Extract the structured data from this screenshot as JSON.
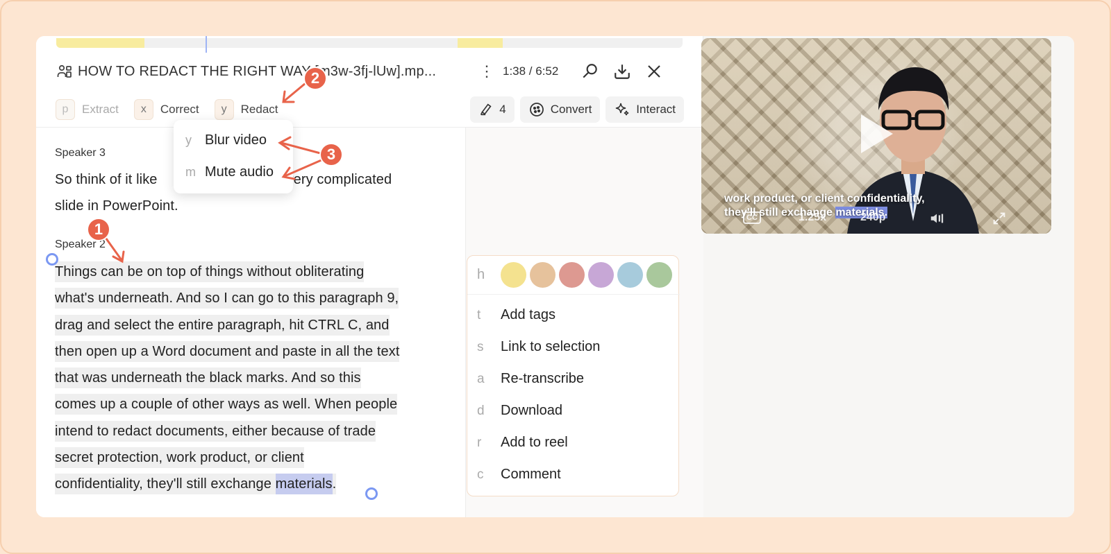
{
  "file": {
    "title": "HOW TO REDACT THE RIGHT WAY [m3w-3fj-lUw].mp...",
    "time": "1:38 / 6:52"
  },
  "toolbar": {
    "extract": {
      "key": "p",
      "label": "Extract"
    },
    "correct": {
      "key": "x",
      "label": "Correct"
    },
    "redact": {
      "key": "y",
      "label": "Redact"
    },
    "highlight_count": "4",
    "convert_label": "Convert",
    "interact_label": "Interact"
  },
  "redact_menu": {
    "items": [
      {
        "key": "y",
        "label": "Blur video"
      },
      {
        "key": "m",
        "label": "Mute audio"
      }
    ]
  },
  "transcript": {
    "blocks": [
      {
        "speaker": "Speaker 3",
        "lines": [
          "So think of it like",
          "very complicated",
          "slide in PowerPoint."
        ]
      },
      {
        "speaker": "Speaker 2",
        "lines": [
          "Things can be on top of things without obliterating",
          "what's underneath. And so I can go to this paragraph 9,",
          "drag and select the entire paragraph, hit CTRL C, and",
          "then open up a Word document and paste in all the text",
          "that was underneath the black marks. And so this",
          "comes up a couple of other ways as well. When people",
          "intend to redact documents, either because of trade",
          "secret protection, work product, or client",
          "confidentiality, they'll still exchange "
        ],
        "highlight_word": "materials",
        "trailing": "."
      }
    ]
  },
  "context_menu": {
    "highlight_key": "h",
    "swatch_colors": [
      "#f4e28f",
      "#e6c29c",
      "#dd9991",
      "#c7a7d6",
      "#a7cbdc",
      "#a9c89c"
    ],
    "items": [
      {
        "key": "t",
        "label": "Add tags"
      },
      {
        "key": "s",
        "label": "Link to selection"
      },
      {
        "key": "a",
        "label": "Re-transcribe"
      },
      {
        "key": "d",
        "label": "Download"
      },
      {
        "key": "r",
        "label": "Add to reel"
      },
      {
        "key": "c",
        "label": "Comment"
      }
    ]
  },
  "video": {
    "caption_line1": "work product, or client confidentiality,",
    "caption_line2_pre": "they'll still exchange ",
    "caption_line2_hl": "materials.",
    "cc_label": "CC",
    "speed": "1.25x",
    "quality": "240p"
  },
  "annotations": [
    "1",
    "2",
    "3"
  ],
  "colors": {
    "accent_annotation": "#e8634a",
    "selection_handle": "#7b98f2",
    "word_highlight": "#c6ccef",
    "page_background": "#fde6d2"
  },
  "icons": [
    "people-icon",
    "kebab-icon",
    "search-icon",
    "download-icon",
    "close-icon",
    "highlighter-icon",
    "convert-icon",
    "sparkle-icon",
    "cc-icon",
    "volume-icon",
    "fullscreen-icon",
    "play-icon"
  ]
}
